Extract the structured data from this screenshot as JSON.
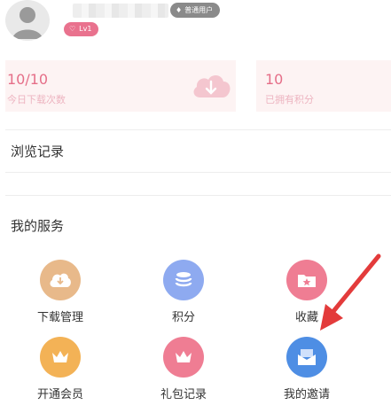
{
  "profile": {
    "user_type_badge": "普通用户",
    "level_badge": "Lv1"
  },
  "stats": [
    {
      "value": "10/10",
      "label": "今日下载次数"
    },
    {
      "value": "10",
      "label": "已拥有积分"
    }
  ],
  "browse_history": {
    "title": "浏览记录"
  },
  "services": {
    "title": "我的服务",
    "items": [
      {
        "label": "下载管理",
        "icon": "download-icon",
        "color": "#e8b98a"
      },
      {
        "label": "积分",
        "icon": "coins-icon",
        "color": "#8eaaf0"
      },
      {
        "label": "收藏",
        "icon": "folder-star-icon",
        "color": "#ef7d93"
      },
      {
        "label": "开通会员",
        "icon": "crown-icon",
        "color": "#f3b256"
      },
      {
        "label": "礼包记录",
        "icon": "gift-icon",
        "color": "#ef7d93"
      },
      {
        "label": "我的邀请",
        "icon": "envelope-icon",
        "color": "#4e8ee4"
      }
    ]
  },
  "annotation_color": "#e33b3b"
}
